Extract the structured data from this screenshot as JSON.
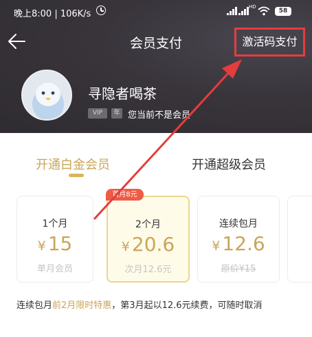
{
  "status_bar": {
    "time_speed": "晚上8:00 | 106K/s",
    "network_label": "HD",
    "battery": "58"
  },
  "nav": {
    "title": "会员支付",
    "activation_code_pay": "激活码支付"
  },
  "profile": {
    "username": "寻隐者喝茶",
    "vip_badge": "VIP",
    "year_badge": "年",
    "member_status": "您当前不是会员"
  },
  "tabs": [
    {
      "label": "开通白金会员",
      "active": true
    },
    {
      "label": "开通超级会员",
      "active": false
    }
  ],
  "plans": [
    {
      "duration": "1个月",
      "currency": "¥",
      "price": "15",
      "note": "单月会员",
      "selected": false
    },
    {
      "duration": "2个月",
      "currency": "¥",
      "price": "20.6",
      "note": "次月12.6元",
      "selected": true,
      "promo": "首月8元"
    },
    {
      "duration": "连续包月",
      "currency": "¥",
      "price": "12.6",
      "note": "原价¥15",
      "selected": false
    }
  ],
  "footnote": {
    "part1": "连续包月",
    "highlight": "前2月限时特惠",
    "part2": "，第3月起以12.6元续费，可随时取消"
  },
  "colors": {
    "header_bg": "#38343a",
    "gold": "#c9a55a",
    "annotation_red": "#e43d3d",
    "promo_red": "#ef5b45"
  }
}
